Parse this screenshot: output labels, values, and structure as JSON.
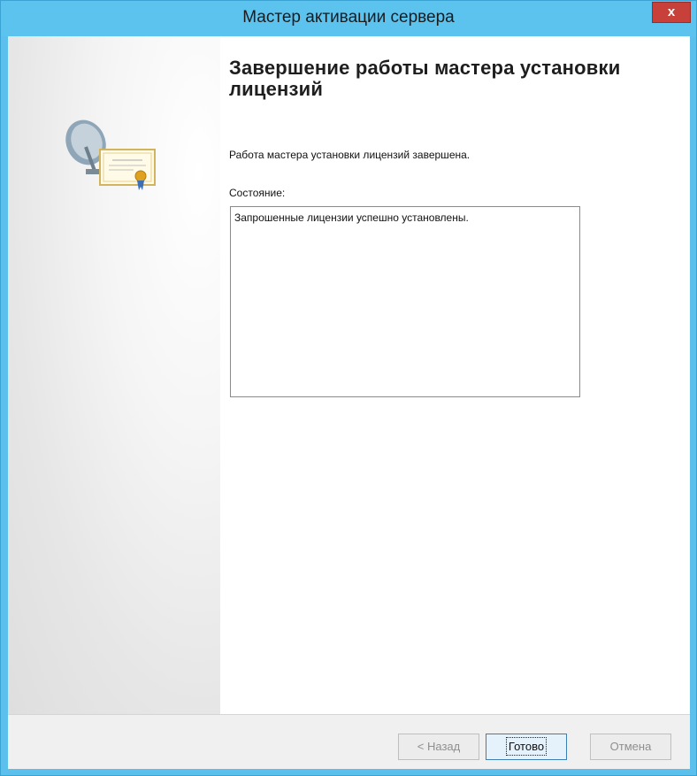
{
  "window": {
    "title": "Мастер активации сервера",
    "close_label": "x"
  },
  "page": {
    "heading": "Завершение работы мастера установки лицензий",
    "description": "Работа мастера установки лицензий завершена.",
    "status_label": "Состояние:",
    "status_text": "Запрошенные лицензии успешно установлены."
  },
  "buttons": {
    "back": "< Назад",
    "finish": "Готово",
    "cancel": "Отмена"
  },
  "icons": {
    "graphic": "satellite-certificate-icon",
    "close": "close-icon"
  },
  "colors": {
    "titlebar": "#5cc2ee",
    "close": "#c7403a"
  }
}
